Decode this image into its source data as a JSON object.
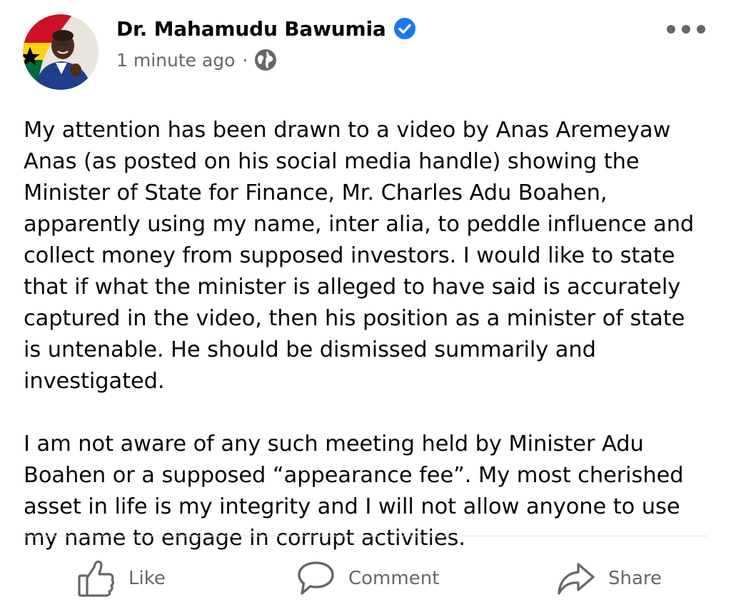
{
  "post": {
    "author": {
      "name": "Dr. Mahamudu Bawumia",
      "verified_badge_icon": "verified-badge-icon"
    },
    "meta": {
      "timestamp": "1 minute ago",
      "separator": "·",
      "audience_icon": "globe-icon"
    },
    "more_icon": "more-options-icon",
    "paragraphs": [
      "My attention has been drawn to a video by Anas Aremeyaw Anas (as posted on his social media handle) showing the Minister of State for Finance, Mr. Charles Adu Boahen, apparently using my name, inter alia, to peddle influence and collect money from supposed investors. I would like to state that if what the minister is alleged to have said is accurately captured in the video, then his position as a minister of state is untenable. He should be dismissed summarily and investigated.",
      "I am not aware of any such meeting held by Minister Adu Boahen or a supposed “appearance fee”. My most cherished asset in life is my integrity and I will not allow anyone to use my name to engage in corrupt activities."
    ],
    "actions": {
      "like": "Like",
      "comment": "Comment",
      "share": "Share"
    }
  },
  "colors": {
    "text_primary": "#050505",
    "text_secondary": "#65676b",
    "verified_blue": "#1877f2",
    "divider": "#dfe1e4"
  }
}
